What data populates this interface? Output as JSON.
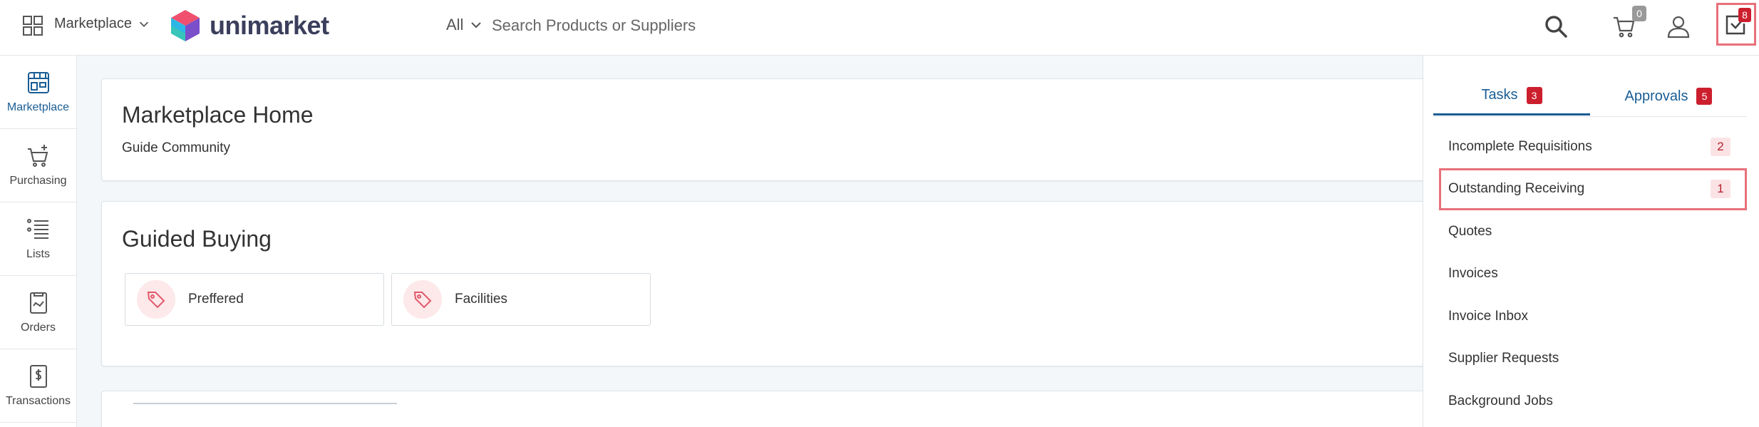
{
  "header": {
    "marketplace_label": "Marketplace",
    "logo_text": "unimarket",
    "search_scope": "All",
    "search_placeholder": "Search Products or Suppliers",
    "cart_count": "0",
    "tasks_count": "8"
  },
  "sidebar": {
    "items": [
      {
        "label": "Marketplace",
        "icon": "storefront-icon",
        "active": true
      },
      {
        "label": "Purchasing",
        "icon": "cart-add-icon"
      },
      {
        "label": "Lists",
        "icon": "list-icon"
      },
      {
        "label": "Orders",
        "icon": "orders-icon"
      },
      {
        "label": "Transactions",
        "icon": "transactions-icon"
      }
    ]
  },
  "main": {
    "home_card": {
      "title": "Marketplace Home",
      "link": "Guide Community"
    },
    "guided_buying": {
      "title": "Guided Buying",
      "tiles": [
        {
          "label": "Preffered",
          "icon": "tag-icon"
        },
        {
          "label": "Facilities",
          "icon": "tag-icon"
        }
      ]
    }
  },
  "panel": {
    "tabs": [
      {
        "label": "Tasks",
        "count": "3",
        "active": true
      },
      {
        "label": "Approvals",
        "count": "5"
      }
    ],
    "tasks": [
      {
        "label": "Incomplete Requisitions",
        "count": "2"
      },
      {
        "label": "Outstanding Receiving",
        "count": "1",
        "highlight": true
      },
      {
        "label": "Quotes"
      },
      {
        "label": "Invoices"
      },
      {
        "label": "Invoice Inbox"
      },
      {
        "label": "Supplier Requests"
      },
      {
        "label": "Background Jobs"
      }
    ]
  },
  "colors": {
    "accent": "#1a5d94",
    "badge_red": "#cc1f2e",
    "highlight_border": "#e8707a",
    "tag_pink": "#fde8ea"
  }
}
